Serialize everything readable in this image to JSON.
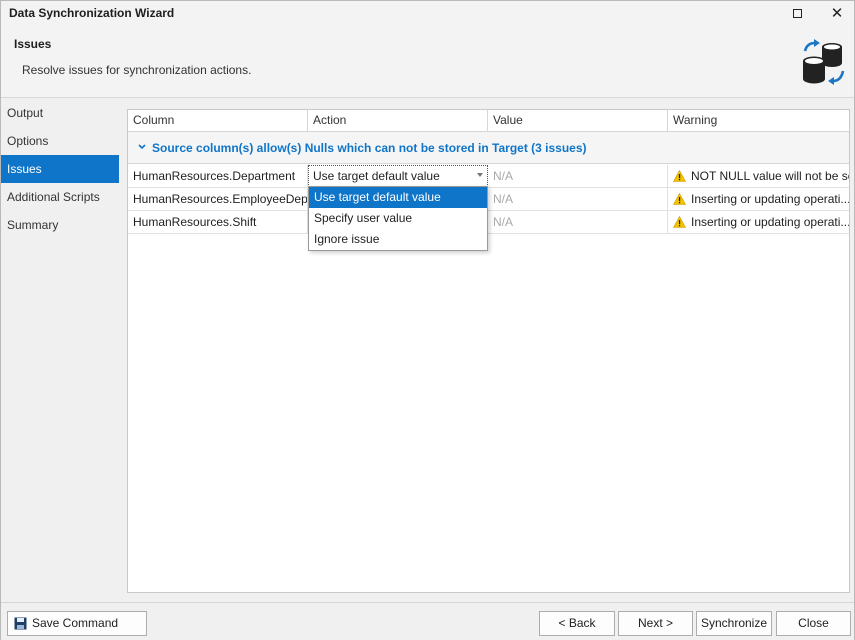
{
  "window": {
    "title": "Data Synchronization Wizard"
  },
  "header": {
    "title": "Issues",
    "subtitle": "Resolve issues for synchronization actions."
  },
  "sidebar": {
    "items": [
      {
        "label": "Output"
      },
      {
        "label": "Options"
      },
      {
        "label": "Issues"
      },
      {
        "label": "Additional Scripts"
      },
      {
        "label": "Summary"
      }
    ],
    "active_index": 2
  },
  "grid": {
    "columns": [
      "Column",
      "Action",
      "Value",
      "Warning"
    ],
    "group": {
      "label": "Source column(s) allow(s) Nulls which can not be stored in Target (3 issues)"
    },
    "rows": [
      {
        "column": "HumanResources.Department",
        "action": "Use target default value",
        "value": "N/A",
        "warning": "NOT NULL value will not be set"
      },
      {
        "column": "HumanResources.EmployeeDep ...",
        "action": "",
        "value": "N/A",
        "warning": "Inserting or updating operati..."
      },
      {
        "column": "HumanResources.Shift",
        "action": "",
        "value": "N/A",
        "warning": "Inserting or updating operati..."
      }
    ],
    "dropdown": {
      "options": [
        "Use target default value",
        "Specify user value",
        "Ignore issue"
      ],
      "selected_index": 0
    }
  },
  "footer": {
    "save_label": "Save Command Line...",
    "back_label": "< Back",
    "next_label": "Next >",
    "synchronize_label": "Synchronize",
    "close_label": "Close"
  },
  "colors": {
    "accent": "#0f75c8",
    "warning": "#f5c400"
  }
}
